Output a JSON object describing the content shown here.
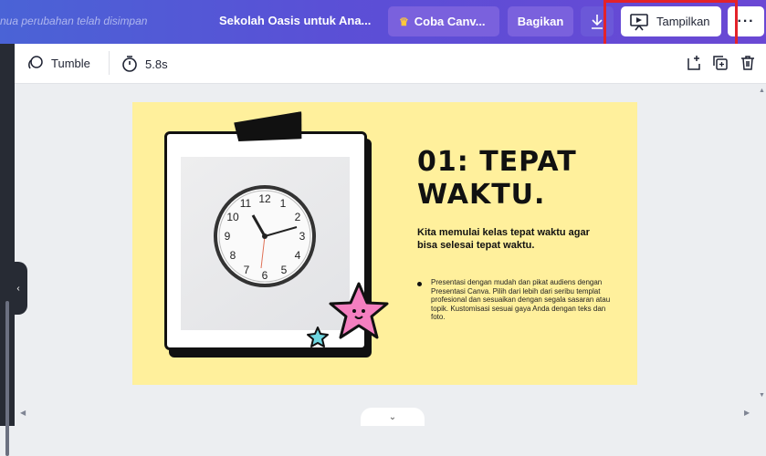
{
  "header": {
    "saved_status": "nua perubahan telah disimpan",
    "doc_title": "Sekolah Oasis untuk Ana...",
    "try_label": "Coba Canv...",
    "share_label": "Bagikan",
    "present_label": "Tampilkan",
    "more_label": "···",
    "accent_color": "#e3222a"
  },
  "toolbar": {
    "animation_label": "Tumble",
    "duration_label": "5.8s"
  },
  "slide": {
    "heading": "01: TEPAT WAKTU.",
    "subtitle": "Kita memulai kelas tepat waktu agar bisa selesai tepat waktu.",
    "bullet": "Presentasi dengan mudah dan pikat audiens dengan Presentasi Canva. Pilih dari lebih dari seribu templat profesional dan sesuaikan dengan segala sasaran atau topik. Kustomisasi sesuai gaya Anda dengan teks dan foto.",
    "background_color": "#fff09c"
  },
  "clock": {
    "numbers": [
      "12",
      "1",
      "2",
      "3",
      "4",
      "5",
      "6",
      "7",
      "8",
      "9",
      "10",
      "11"
    ]
  },
  "icons": {
    "crown": "crown-icon",
    "download": "download-icon",
    "present": "present-icon",
    "animation": "animation-icon",
    "timer": "timer-icon",
    "add_page": "add-page-icon",
    "duplicate": "duplicate-icon",
    "trash": "trash-icon"
  }
}
